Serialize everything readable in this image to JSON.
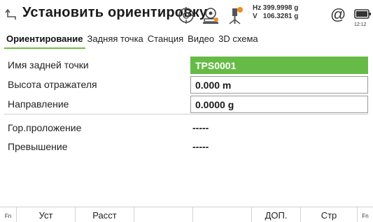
{
  "header": {
    "title": "Установить ориентировку",
    "hz_label": "Hz",
    "hz_value": "399.9998 g",
    "v_label": "V",
    "v_value": "106.3281 g",
    "at_symbol": "@",
    "battery_time": "12:12",
    "icons": [
      "back-arrow-icon",
      "level-bubble-icon",
      "instrument-target-icon",
      "prism-warning-icon",
      "battery-icon"
    ]
  },
  "tabs": [
    {
      "label": "Ориентирование",
      "active": true
    },
    {
      "label": "Задняя точка",
      "active": false
    },
    {
      "label": "Станция",
      "active": false
    },
    {
      "label": "Видео",
      "active": false
    },
    {
      "label": "3D схема",
      "active": false
    }
  ],
  "fields": {
    "backsight_name": {
      "label": "Имя задней точки",
      "value": "TPS0001"
    },
    "reflector_height": {
      "label": "Высота отражателя",
      "value": "0.000 m"
    },
    "direction": {
      "label": "Направление",
      "value": "0.0000 g"
    },
    "horizontal_distance": {
      "label": "Гор.проложение",
      "value": "-----"
    },
    "height_difference": {
      "label": "Превышение",
      "value": "-----"
    }
  },
  "softkeys": {
    "fn_left": "Fn",
    "set": "Уст",
    "dist": "Расст",
    "more": "ДОП.",
    "page": "Стр",
    "fn_right": "Fn"
  },
  "colors": {
    "accent_green": "#66bb46",
    "warning_orange": "#f08a24"
  }
}
